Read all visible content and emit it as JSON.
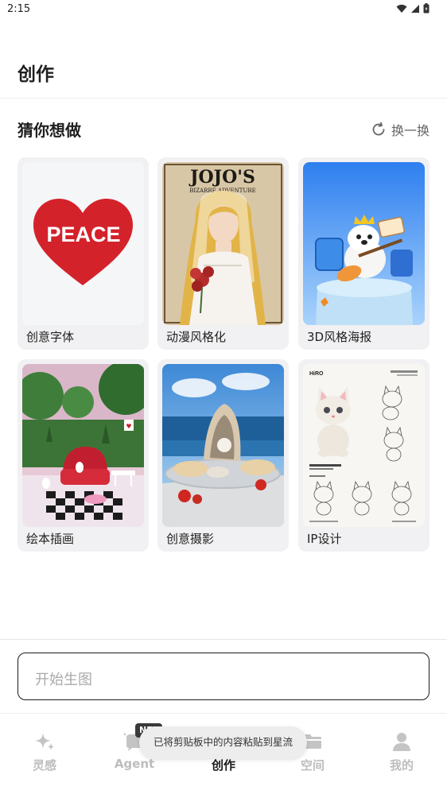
{
  "status_bar": {
    "time": "2:15"
  },
  "header": {
    "title": "创作"
  },
  "suggest": {
    "title": "猜你想做",
    "refresh_label": "换一换"
  },
  "cards": [
    {
      "label": "创意字体",
      "art_text": "PEACE"
    },
    {
      "label": "动漫风格化",
      "art_text": "JOJO'S",
      "art_subtext": "BIZARRE ADVENTURE"
    },
    {
      "label": "3D风格海报"
    },
    {
      "label": "绘本插画"
    },
    {
      "label": "创意摄影"
    },
    {
      "label": "IP设计",
      "art_text": "HiRO"
    }
  ],
  "prompt": {
    "placeholder": "开始生图"
  },
  "tabs": [
    {
      "label": "灵感",
      "icon": "sparkle-icon"
    },
    {
      "label": "Agent",
      "icon": "agent-chat-icon",
      "badge": "NEW"
    },
    {
      "label": "创作",
      "icon": "create-icon",
      "active": true
    },
    {
      "label": "空间",
      "icon": "folder-icon"
    },
    {
      "label": "我的",
      "icon": "person-icon"
    }
  ],
  "toast": {
    "text": "已将剪贴板中的内容粘贴到星流"
  },
  "colors": {
    "accent_text": "#1f1f1f",
    "inactive_tab": "#bdbdbd",
    "card_bg": "#f1f1f3"
  }
}
